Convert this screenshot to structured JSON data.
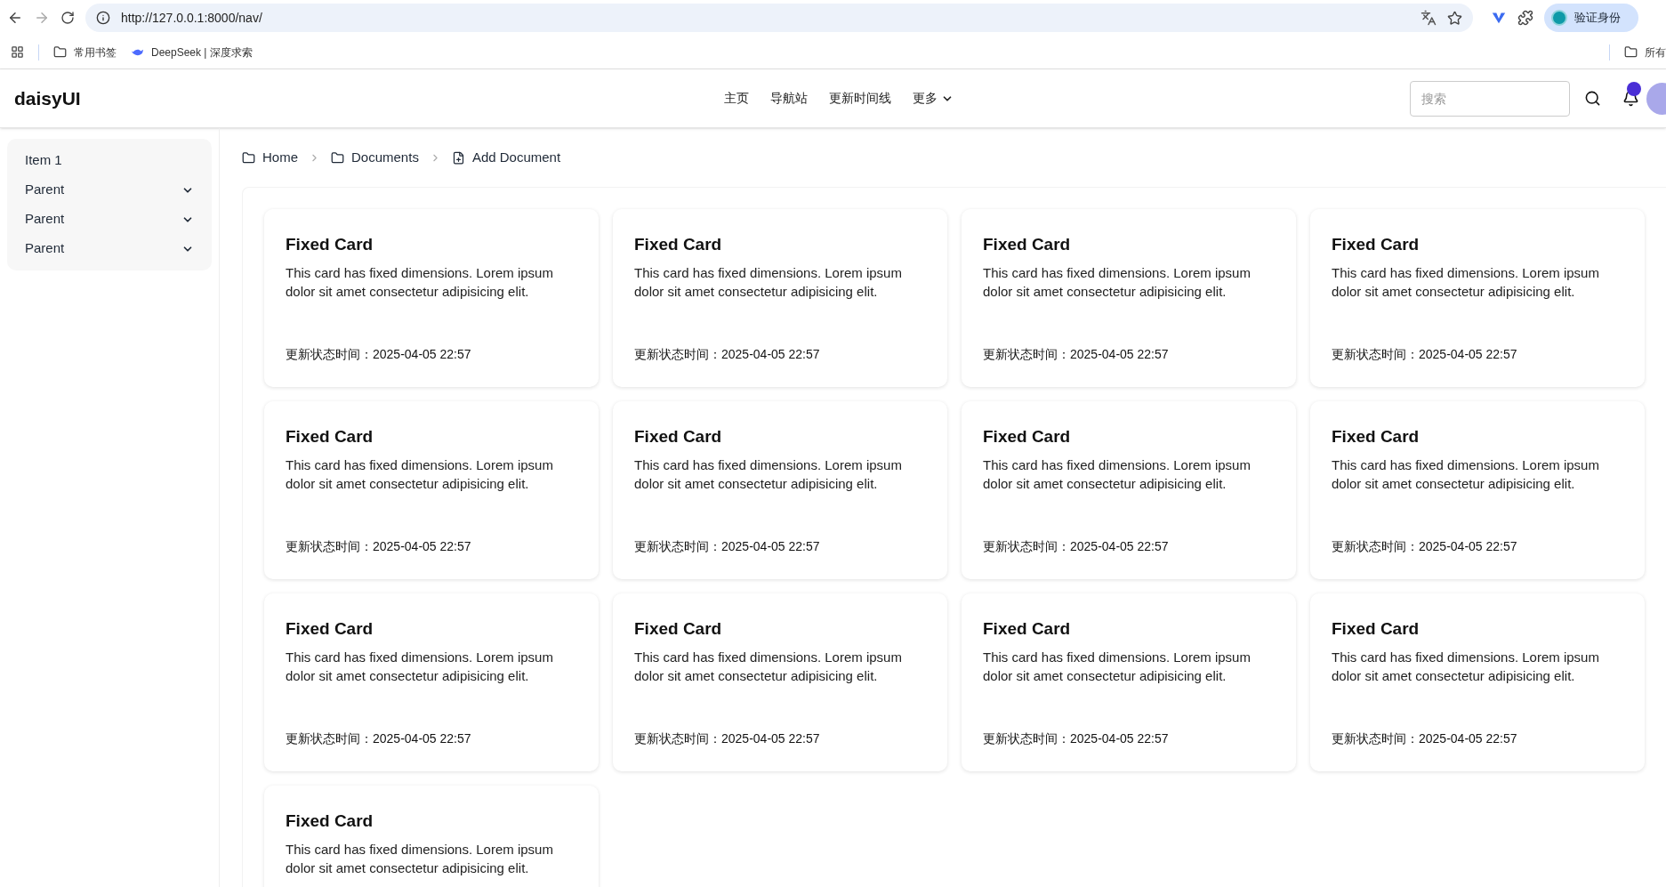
{
  "browser": {
    "url": "http://127.0.0.1:8000/nav/",
    "profile": "验证身份",
    "bookmarks": [
      {
        "label": "常用书签",
        "kind": "folder"
      },
      {
        "label": "DeepSeek | 深度求索",
        "kind": "site"
      }
    ],
    "other_bookmarks": "所有"
  },
  "navbar": {
    "brand": "daisyUI",
    "links": [
      {
        "label": "主页",
        "kind": "link"
      },
      {
        "label": "导航站",
        "kind": "link"
      },
      {
        "label": "更新时间线",
        "kind": "link"
      },
      {
        "label": "更多",
        "kind": "dropdown"
      }
    ],
    "search": {
      "placeholder": "搜索"
    },
    "notification_dot": true
  },
  "sidebar": {
    "items": [
      {
        "label": "Item 1",
        "kind": "item"
      },
      {
        "label": "Parent",
        "kind": "parent"
      },
      {
        "label": "Parent",
        "kind": "parent"
      },
      {
        "label": "Parent",
        "kind": "parent"
      }
    ]
  },
  "breadcrumbs": [
    {
      "label": "Home",
      "kind": "folder"
    },
    {
      "label": "Documents",
      "kind": "folder"
    },
    {
      "label": "Add Document",
      "kind": "file"
    }
  ],
  "cards": [
    {
      "title": "Fixed Card",
      "body": "This card has fixed dimensions. Lorem ipsum dolor sit amet consectetur adipisicing elit.",
      "updated": "更新状态时间：2025-04-05 22:57"
    },
    {
      "title": "Fixed Card",
      "body": "This card has fixed dimensions. Lorem ipsum dolor sit amet consectetur adipisicing elit.",
      "updated": "更新状态时间：2025-04-05 22:57"
    },
    {
      "title": "Fixed Card",
      "body": "This card has fixed dimensions. Lorem ipsum dolor sit amet consectetur adipisicing elit.",
      "updated": "更新状态时间：2025-04-05 22:57"
    },
    {
      "title": "Fixed Card",
      "body": "This card has fixed dimensions. Lorem ipsum dolor sit amet consectetur adipisicing elit.",
      "updated": "更新状态时间：2025-04-05 22:57"
    },
    {
      "title": "Fixed Card",
      "body": "This card has fixed dimensions. Lorem ipsum dolor sit amet consectetur adipisicing elit.",
      "updated": "更新状态时间：2025-04-05 22:57"
    },
    {
      "title": "Fixed Card",
      "body": "This card has fixed dimensions. Lorem ipsum dolor sit amet consectetur adipisicing elit.",
      "updated": "更新状态时间：2025-04-05 22:57"
    },
    {
      "title": "Fixed Card",
      "body": "This card has fixed dimensions. Lorem ipsum dolor sit amet consectetur adipisicing elit.",
      "updated": "更新状态时间：2025-04-05 22:57"
    },
    {
      "title": "Fixed Card",
      "body": "This card has fixed dimensions. Lorem ipsum dolor sit amet consectetur adipisicing elit.",
      "updated": "更新状态时间：2025-04-05 22:57"
    },
    {
      "title": "Fixed Card",
      "body": "This card has fixed dimensions. Lorem ipsum dolor sit amet consectetur adipisicing elit.",
      "updated": "更新状态时间：2025-04-05 22:57"
    },
    {
      "title": "Fixed Card",
      "body": "This card has fixed dimensions. Lorem ipsum dolor sit amet consectetur adipisicing elit.",
      "updated": "更新状态时间：2025-04-05 22:57"
    },
    {
      "title": "Fixed Card",
      "body": "This card has fixed dimensions. Lorem ipsum dolor sit amet consectetur adipisicing elit.",
      "updated": "更新状态时间：2025-04-05 22:57"
    },
    {
      "title": "Fixed Card",
      "body": "This card has fixed dimensions. Lorem ipsum dolor sit amet consectetur adipisicing elit.",
      "updated": "更新状态时间：2025-04-05 22:57"
    },
    {
      "title": "Fixed Card",
      "body": "This card has fixed dimensions. Lorem ipsum dolor sit amet consectetur adipisicing elit."
    }
  ]
}
